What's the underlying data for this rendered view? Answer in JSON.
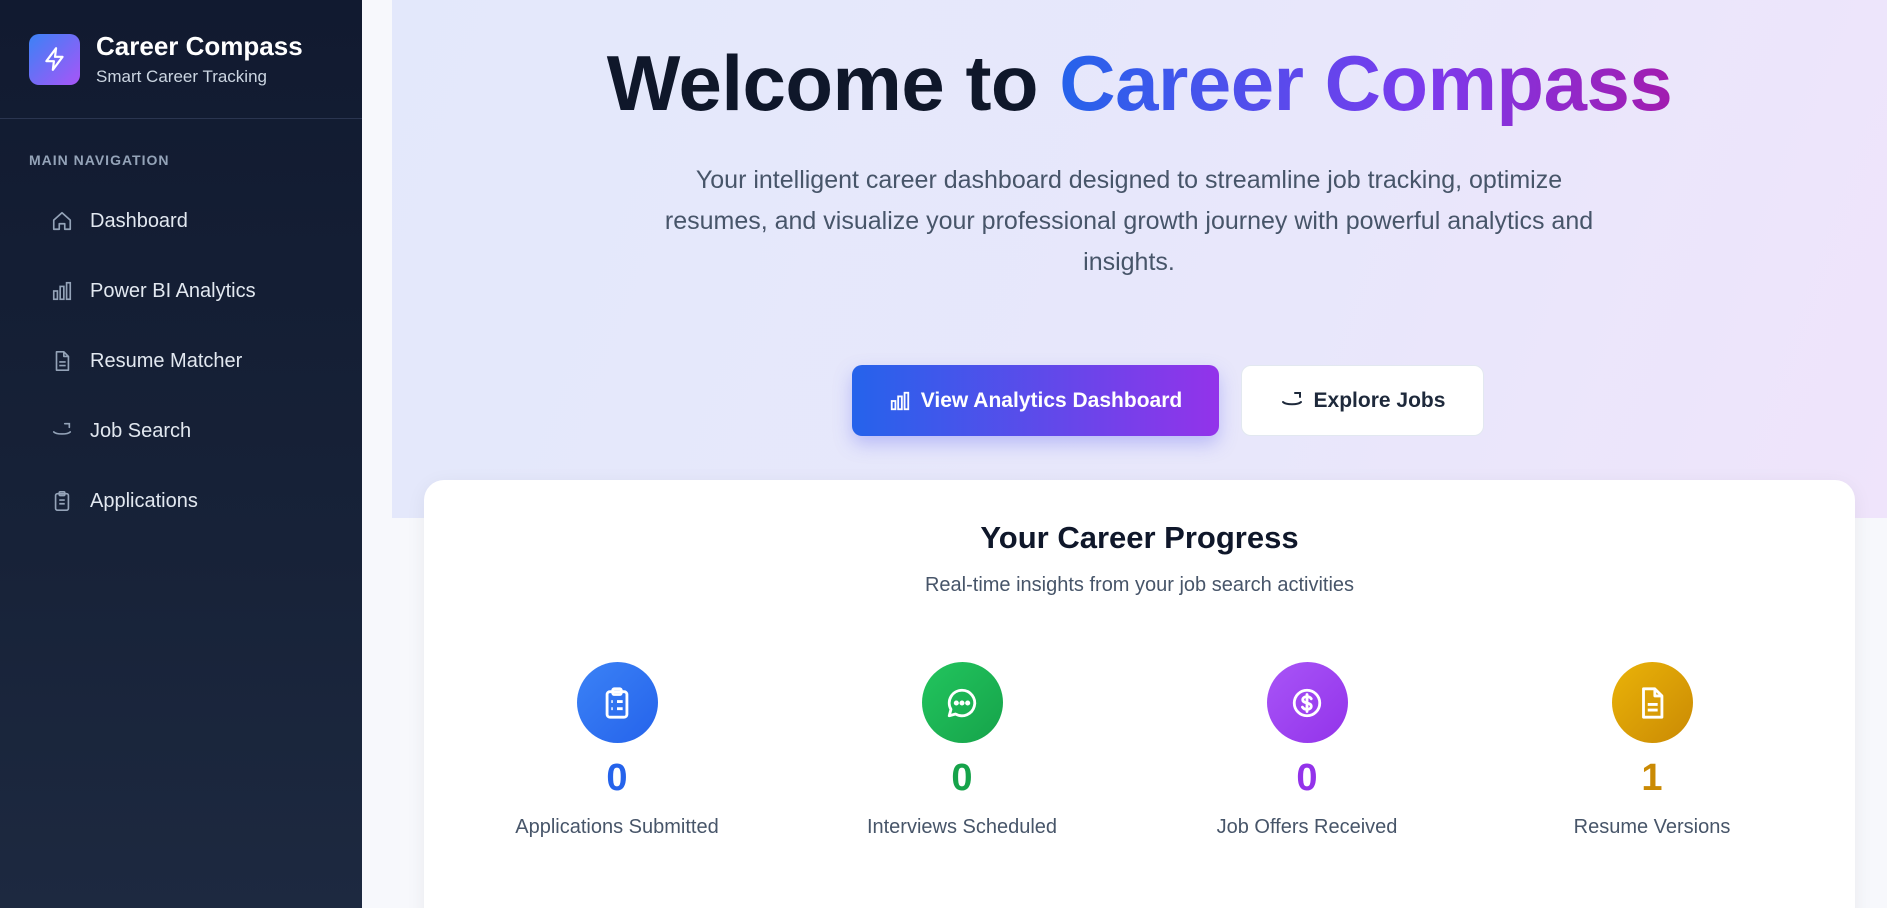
{
  "brand": {
    "title": "Career Compass",
    "subtitle": "Smart Career Tracking"
  },
  "nav": {
    "section_label": "MAIN NAVIGATION",
    "items": [
      {
        "label": "Dashboard",
        "icon": "home-icon"
      },
      {
        "label": "Power BI Analytics",
        "icon": "bar-chart-icon"
      },
      {
        "label": "Resume Matcher",
        "icon": "document-icon"
      },
      {
        "label": "Job Search",
        "icon": "briefcase-icon"
      },
      {
        "label": "Applications",
        "icon": "clipboard-icon"
      }
    ]
  },
  "hero": {
    "title_prefix": "Welcome to",
    "title_highlight": "Career Compass",
    "description": "Your intelligent career dashboard designed to streamline job tracking, optimize resumes, and visualize your professional growth journey with powerful analytics and insights.",
    "primary_button": "View Analytics Dashboard",
    "secondary_button": "Explore Jobs"
  },
  "progress": {
    "title": "Your Career Progress",
    "subtitle": "Real-time insights from your job search activities",
    "stats": [
      {
        "value": "0",
        "label": "Applications Submitted",
        "color": "#2563eb",
        "icon": "clipboard-list-icon"
      },
      {
        "value": "0",
        "label": "Interviews Scheduled",
        "color": "#16a34a",
        "icon": "chat-bubble-icon"
      },
      {
        "value": "0",
        "label": "Job Offers Received",
        "color": "#9333ea",
        "icon": "dollar-icon"
      },
      {
        "value": "1",
        "label": "Resume Versions",
        "color": "#ca8a04",
        "icon": "file-icon"
      }
    ]
  },
  "colors": {
    "accent_blue": "#2563eb",
    "accent_purple": "#9333ea",
    "sidebar_bg": "#111a30"
  }
}
